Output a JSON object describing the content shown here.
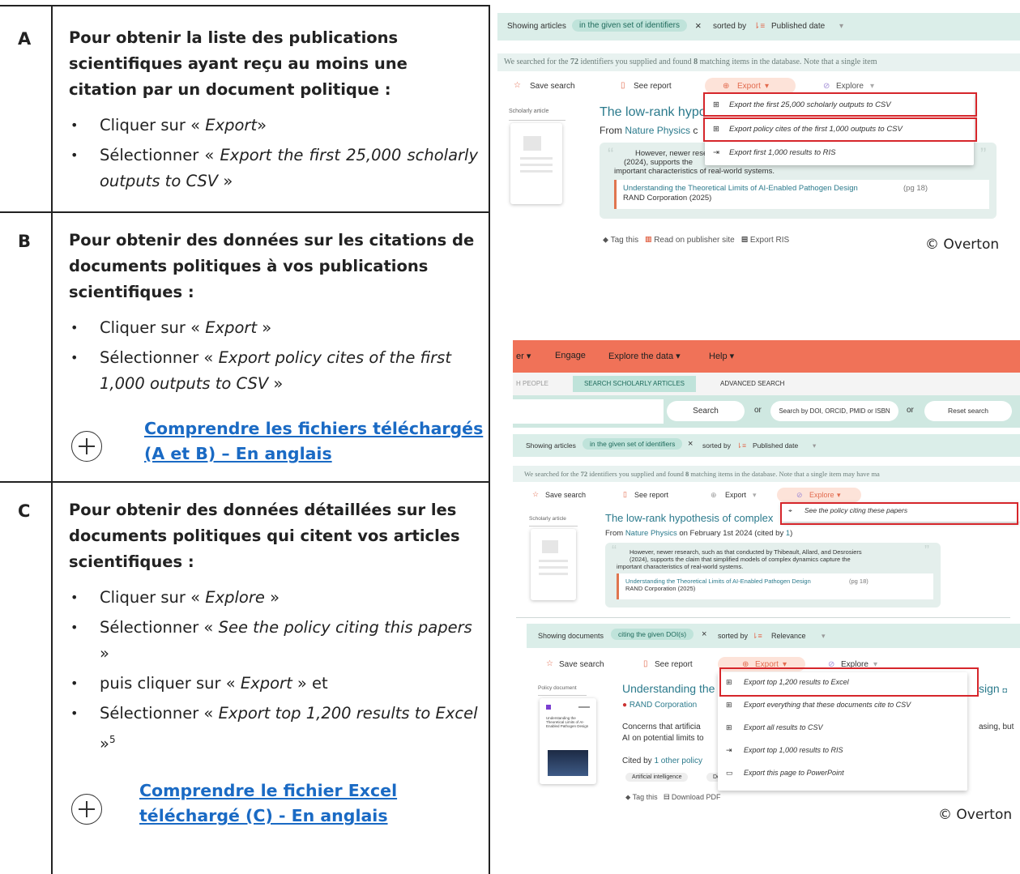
{
  "section_a": {
    "letter": "A",
    "heading": "Pour obtenir la liste des publications scientifiques ayant reçu au moins une citation par un document politique :",
    "step1_prefix": "Cliquer sur « ",
    "step1_em": "Export",
    "step1_suffix": "»",
    "step2_prefix": "Sélectionner « ",
    "step2_em": "Export the first 25,000 scholarly outputs to CSV",
    "step2_suffix": " »"
  },
  "section_b": {
    "letter": "B",
    "heading": "Pour obtenir des données sur les citations de documents politiques à vos publications scientifiques :",
    "step1_prefix": "Cliquer sur « ",
    "step1_em": "Export",
    "step1_suffix": " »",
    "step2_prefix": "Sélectionner « ",
    "step2_em": "Export policy cites of the first 1,000 outputs to CSV",
    "step2_suffix": " »",
    "link": "Comprendre les fichiers téléchargés (A et B) – En anglais"
  },
  "section_c": {
    "letter": "C",
    "heading": "Pour obtenir des données détaillées sur les documents politiques qui citent vos articles scientifiques :",
    "step1_prefix": "Cliquer sur « ",
    "step1_em": "Explore",
    "step1_suffix": " »",
    "step2_prefix": "Sélectionner « ",
    "step2_em": "See the policy citing this papers",
    "step2_suffix": " »",
    "step3_prefix": "puis cliquer sur « ",
    "step3_em": "Export",
    "step3_suffix": " » et",
    "step4_prefix": "Sélectionner « ",
    "step4_em": "Export top 1,200 results to Excel",
    "step4_suffix": " »",
    "step4_sup": "5",
    "link": "Comprendre le fichier Excel téléchargé (C) - En anglais"
  },
  "shot1": {
    "showing": "Showing articles",
    "filter_chip": "in the given set of identifiers",
    "close": "×",
    "sorted_by": "sorted by",
    "sort_value": "Published date",
    "notice_a": "We searched for the ",
    "notice_n1": "72",
    "notice_b": " identifiers you supplied and found ",
    "notice_n2": "8",
    "notice_c": " matching items in the database. Note that a single item",
    "save_search": "Save search",
    "see_report": "See report",
    "export": "Export",
    "explore": "Explore",
    "type_tag": "Scholarly article",
    "title": "The low-rank hypo",
    "from_label": "From ",
    "journal": "Nature Physics",
    "from_rest": " c",
    "quote_text": "However, newer rese",
    "quote_line2": "(2024), supports the",
    "quote_line3": "important characteristics of real-world systems.",
    "ref_title": "Understanding the Theoretical Limits of AI-Enabled Pathogen Design",
    "ref_page": " (pg 18)",
    "ref_org": "RAND Corporation (2025)",
    "tag_this": "Tag this",
    "read_publisher": "Read on publisher site",
    "export_ris": "Export RIS",
    "menu_items": [
      "Export the first 25,000 scholarly outputs to CSV",
      "Export policy cites of the first 1,000 outputs to CSV",
      "Export first 1,000 results to RIS"
    ],
    "copyright": "© Overton"
  },
  "shot2": {
    "nav_partial": "er",
    "nav_engage": "Engage",
    "nav_explore": "Explore the data",
    "nav_help": "Help",
    "tab_people": "H PEOPLE",
    "tab_scholarly": "SEARCH SCHOLARLY ARTICLES",
    "tab_advanced": "ADVANCED SEARCH",
    "search_btn": "Search",
    "or1": "or",
    "doi_btn": "Search by DOI, ORCID, PMID or ISBN",
    "or2": "or",
    "reset_btn": "Reset search",
    "showing": "Showing articles",
    "filter_chip": "in the given set of identifiers",
    "close": "×",
    "sorted_by": "sorted by",
    "sort_value": "Published date",
    "notice_a": "We searched for the ",
    "notice_n1": "72",
    "notice_b": " identifiers you supplied and found ",
    "notice_n2": "8",
    "notice_c": " matching items in the database. Note that a single item may have ma",
    "save_search": "Save search",
    "see_report": "See report",
    "export": "Export",
    "explore": "Explore",
    "explore_item": "See the policy citing these papers",
    "type_tag": "Scholarly article",
    "title": "The low-rank hypothesis of complex",
    "from_label": "From ",
    "journal": "Nature Physics",
    "from_rest": " on February 1st 2024 (cited by ",
    "cited_n": "1",
    "from_end": ")",
    "quote_line1": "However, newer research, such as that conducted by Thibeault, Allard, and Desrosiers",
    "quote_line2": "(2024), supports the claim that simplified models of complex dynamics capture the",
    "quote_line3": "important characteristics of real-world systems.",
    "ref_title": "Understanding the Theoretical Limits of AI-Enabled Pathogen Design",
    "ref_page": " (pg 18)",
    "ref_org": "RAND Corporation (2025)"
  },
  "shot3": {
    "showing": "Showing documents",
    "filter_chip": "citing the given DOI(s)",
    "close": "×",
    "sorted_by": "sorted by",
    "sort_value": "Relevance",
    "save_search": "Save search",
    "see_report": "See report",
    "export": "Export",
    "explore": "Explore",
    "type_tag": "Policy document",
    "thumb_text": "Understanding the Theoretical Limits of AI-Enabled Pathogen Design",
    "title": "Understanding the",
    "title_end": "sign",
    "org": "RAND Corporation",
    "body1": "Concerns that artificia",
    "body1_end": "asing, but",
    "body2": "AI on potential limits to",
    "cited_by": "Cited by ",
    "cited_link": "1 other policy",
    "tag1": "Artificial intelligence",
    "tag2": "De",
    "tag_this": "Tag this",
    "download_pdf": "Download PDF",
    "menu_items": [
      "Export top 1,200 results to Excel",
      "Export everything that these documents cite to CSV",
      "Export all results to CSV",
      "Export top 1,000 results to RIS",
      "Export this page to PowerPoint"
    ],
    "copyright": "© Overton"
  }
}
